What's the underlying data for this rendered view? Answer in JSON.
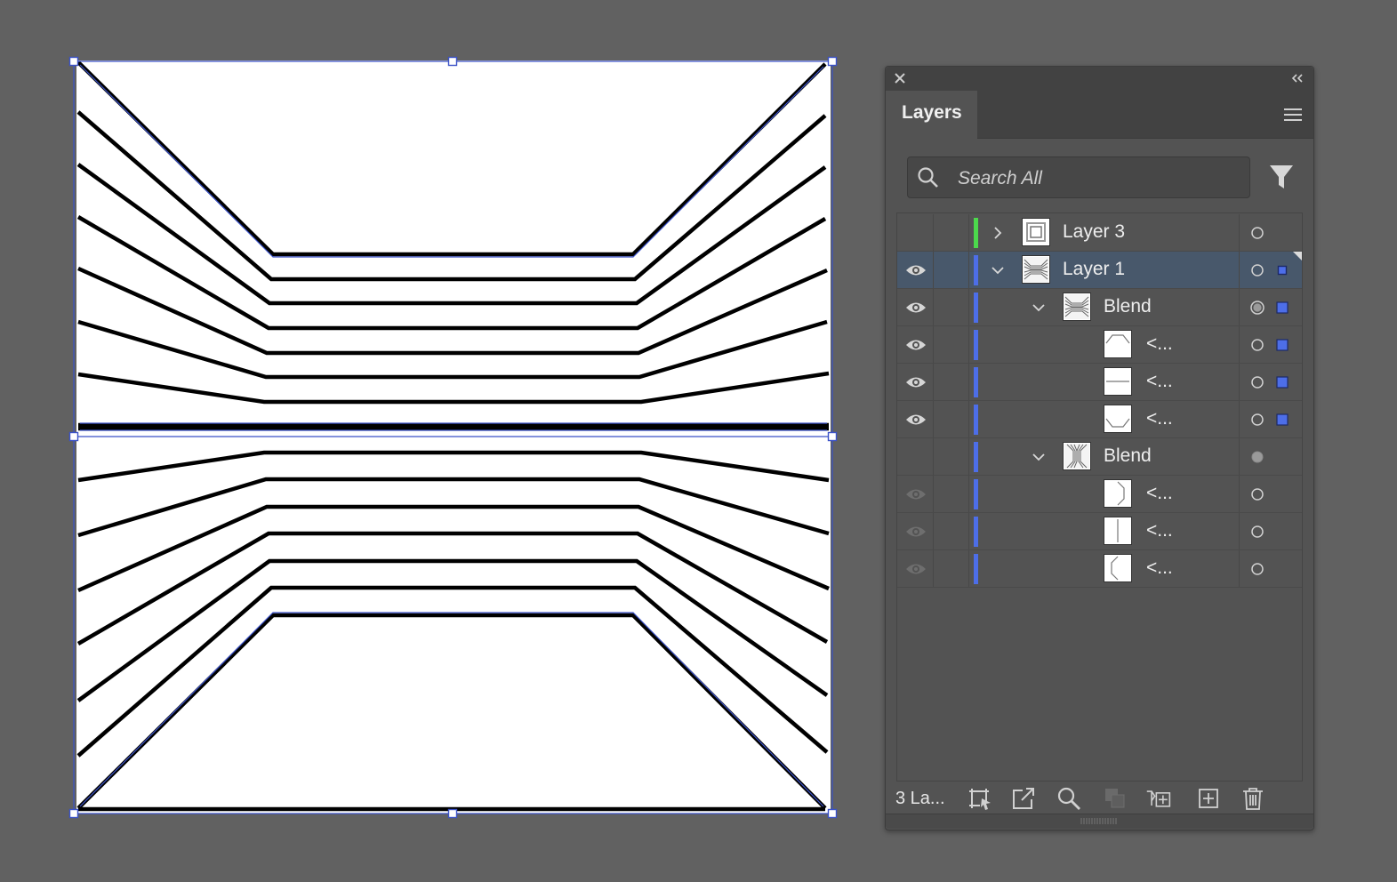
{
  "colors": {
    "app_background": "#616161",
    "panel_background": "#535353",
    "selection_blue": "#3b52c8",
    "layer3_color": "#4cd94c",
    "layer1_color": "#4d6ee8",
    "selected_row": "#48586b"
  },
  "panel": {
    "tab_label": "Layers",
    "search_placeholder": "Search All",
    "layer_count": "3 La..."
  },
  "layers": [
    {
      "label": "Layer 3",
      "visible": false,
      "expanded": false,
      "level": 0,
      "color": "layer3",
      "thumb": "frame",
      "target": "empty",
      "selected_square": false
    },
    {
      "label": "Layer 1",
      "visible": true,
      "expanded": true,
      "level": 0,
      "color": "layer1",
      "thumb": "blend-h",
      "target": "empty",
      "selected_square": "small",
      "row_selected": true
    },
    {
      "label": "Blend",
      "visible": true,
      "expanded": true,
      "level": 1,
      "color": "layer1",
      "thumb": "blend-h",
      "target": "targeted",
      "selected_square": "large"
    },
    {
      "label": "<...",
      "visible": true,
      "level": 2,
      "color": "layer1",
      "thumb": "path-top",
      "target": "empty",
      "selected_square": "large"
    },
    {
      "label": "<...",
      "visible": true,
      "level": 2,
      "color": "layer1",
      "thumb": "path-mid",
      "target": "empty",
      "selected_square": "large"
    },
    {
      "label": "<...",
      "visible": true,
      "level": 2,
      "color": "layer1",
      "thumb": "path-bottom",
      "target": "empty",
      "selected_square": "large"
    },
    {
      "label": "Blend",
      "visible": false,
      "expanded": true,
      "level": 1,
      "color": "layer1",
      "thumb": "blend-v",
      "target": "filled",
      "selected_square": false
    },
    {
      "label": "<...",
      "visible": "dim",
      "level": 2,
      "color": "layer1",
      "thumb": "path-right",
      "target": "empty",
      "selected_square": false
    },
    {
      "label": "<...",
      "visible": "dim",
      "level": 2,
      "color": "layer1",
      "thumb": "path-vmid",
      "target": "empty",
      "selected_square": false
    },
    {
      "label": "<...",
      "visible": "dim",
      "level": 2,
      "color": "layer1",
      "thumb": "path-left",
      "target": "empty",
      "selected_square": false
    }
  ],
  "footer_icons": [
    "collect-for-export-icon",
    "export-icon",
    "locate-object-icon",
    "make-clipping-mask-icon",
    "new-sublayer-icon",
    "new-layer-icon",
    "delete-icon"
  ],
  "icons": {
    "close": "close-icon",
    "collapse": "collapse-panel-icon",
    "menu": "panel-menu-icon",
    "search": "search-icon",
    "filter": "filter-icon",
    "eye": "eye-icon"
  }
}
